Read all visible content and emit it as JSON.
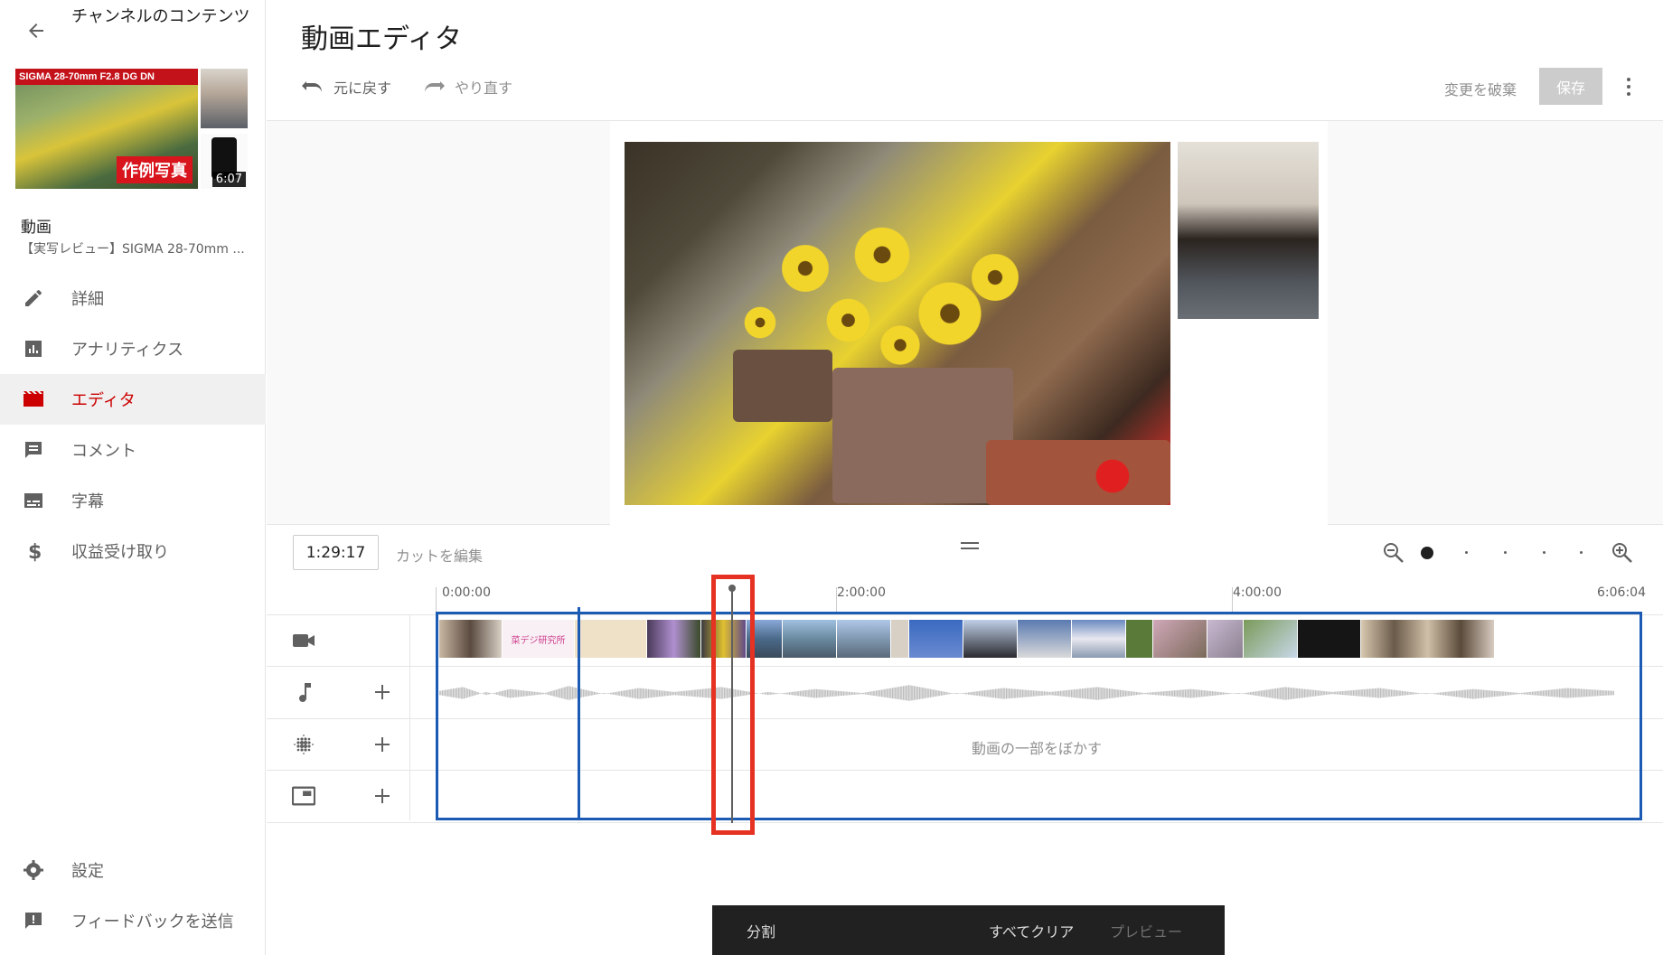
{
  "sidebar": {
    "channel_title": "チャンネルのコンテンツ",
    "thumbnail_banner": "SIGMA 28-70mm F2.8 DG DN",
    "thumbnail_tag": "作例写真",
    "duration": "6:07",
    "video_label": "動画",
    "video_title": "【実写レビュー】SIGMA 28-70mm ...",
    "items": [
      {
        "label": "詳細",
        "icon": "pencil-icon"
      },
      {
        "label": "アナリティクス",
        "icon": "analytics-icon"
      },
      {
        "label": "エディタ",
        "icon": "clapperboard-icon",
        "active": true
      },
      {
        "label": "コメント",
        "icon": "comment-icon"
      },
      {
        "label": "字幕",
        "icon": "subtitles-icon"
      },
      {
        "label": "収益受け取り",
        "icon": "dollar-icon"
      }
    ],
    "bottom_items": [
      {
        "label": "設定",
        "icon": "gear-icon"
      },
      {
        "label": "フィードバックを送信",
        "icon": "feedback-icon"
      }
    ]
  },
  "header": {
    "title": "動画エディタ",
    "undo_label": "元に戻す",
    "redo_label": "やり直す",
    "discard_label": "変更を破棄",
    "save_label": "保存"
  },
  "timeline": {
    "timecode": "1:29:17",
    "cut_edit_label": "カットを編集",
    "ruler": [
      "0:00:00",
      "2:00:00",
      "4:00:00",
      "6:06:04"
    ],
    "blur_label": "動画の一部をぼかす",
    "intro_frame_text": "菜デジ研究所"
  },
  "action_bar": {
    "split_label": "分割",
    "clear_label": "すべてクリア",
    "preview_label": "プレビュー"
  },
  "colors": {
    "accent_red": "#cc0000",
    "highlight_red": "#e63223",
    "timeline_blue": "#1b5bb4"
  }
}
